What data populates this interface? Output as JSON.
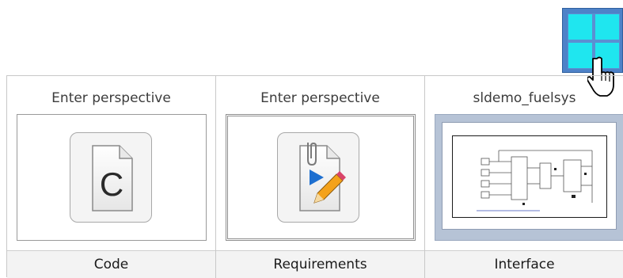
{
  "perspectives_button": {
    "icon": "grid-2x2-icon",
    "accent": "#1fe6ef"
  },
  "cursor": {
    "icon": "hand-pointer-icon"
  },
  "tiles": [
    {
      "top_label": "Enter perspective",
      "bottom_label": "Code",
      "icon": "c-file-icon"
    },
    {
      "top_label": "Enter perspective",
      "bottom_label": "Requirements",
      "icon": "requirements-file-icon"
    },
    {
      "top_label": "sldemo_fuelsys",
      "bottom_label": "Interface",
      "icon": "model-thumbnail"
    }
  ]
}
